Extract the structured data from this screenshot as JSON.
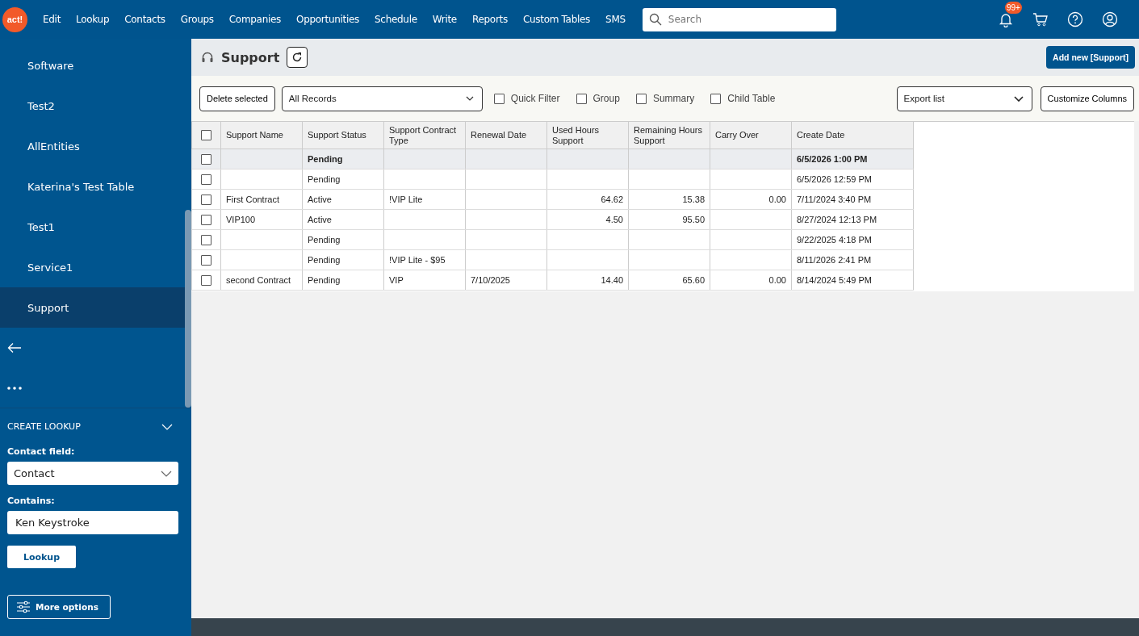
{
  "top_bar": {
    "logo": "act!",
    "menu": [
      "Edit",
      "Lookup",
      "Contacts",
      "Groups",
      "Companies",
      "Opportunities",
      "Schedule",
      "Write",
      "Reports",
      "Custom Tables",
      "SMS"
    ],
    "search": {
      "placeholder": "Search"
    },
    "notification_badge": "99+"
  },
  "sidebar": {
    "items": [
      {
        "label": "Software",
        "selected": false
      },
      {
        "label": "Test2",
        "selected": false
      },
      {
        "label": "AllEntities",
        "selected": false
      },
      {
        "label": "Katerina's Test Table",
        "selected": false
      },
      {
        "label": "Test1",
        "selected": false
      },
      {
        "label": "Service1",
        "selected": false
      },
      {
        "label": "Support",
        "selected": true
      }
    ],
    "lookup": {
      "title": "CREATE LOOKUP",
      "field_label": "Contact field:",
      "field_value": "Contact",
      "contains_label": "Contains:",
      "contains_value": "Ken Keystroke",
      "lookup_button": "Lookup",
      "more_options": "More options"
    }
  },
  "page": {
    "title": "Support",
    "add_button": "Add new [Support]"
  },
  "toolbar": {
    "delete_button": "Delete selected",
    "view_select": "All Records",
    "checkboxes": [
      {
        "label": "Quick Filter",
        "checked": false
      },
      {
        "label": "Group",
        "checked": false
      },
      {
        "label": "Summary",
        "checked": false
      },
      {
        "label": "Child Table",
        "checked": false
      }
    ],
    "export_select": "Export list",
    "customize_button": "Customize Columns"
  },
  "table": {
    "select_all_checked": false,
    "columns": [
      {
        "label": "Support Name",
        "kind": "text"
      },
      {
        "label": "Support Status",
        "kind": "text"
      },
      {
        "label": "Support Contract Type",
        "kind": "text"
      },
      {
        "label": "Renewal Date",
        "kind": "text"
      },
      {
        "label": "Used Hours Support",
        "kind": "number"
      },
      {
        "label": "Remaining Hours Support",
        "kind": "number"
      },
      {
        "label": "Carry Over",
        "kind": "number"
      },
      {
        "label": "Create Date",
        "kind": "text"
      }
    ],
    "rows": [
      {
        "selected": true,
        "checked": false,
        "cells": [
          "",
          "Pending",
          "",
          "",
          "",
          "",
          "",
          "6/5/2026 1:00 PM"
        ]
      },
      {
        "selected": false,
        "checked": false,
        "cells": [
          "",
          "Pending",
          "",
          "",
          "",
          "",
          "",
          "6/5/2026 12:59 PM"
        ]
      },
      {
        "selected": false,
        "checked": false,
        "cells": [
          "First Contract",
          "Active",
          "!VIP Lite",
          "",
          "64.62",
          "15.38",
          "0.00",
          "7/11/2024 3:40 PM"
        ]
      },
      {
        "selected": false,
        "checked": false,
        "cells": [
          "VIP100",
          "Active",
          "",
          "",
          "4.50",
          "95.50",
          "",
          "8/27/2024 12:13 PM"
        ]
      },
      {
        "selected": false,
        "checked": false,
        "cells": [
          "",
          "Pending",
          "",
          "",
          "",
          "",
          "",
          "9/22/2025 4:18 PM"
        ]
      },
      {
        "selected": false,
        "checked": false,
        "cells": [
          "",
          "Pending",
          "!VIP Lite - $95",
          "",
          "",
          "",
          "",
          "8/11/2026 2:41 PM"
        ]
      },
      {
        "selected": false,
        "checked": false,
        "cells": [
          "second Contract",
          "Pending",
          "VIP",
          "7/10/2025",
          "14.40",
          "65.60",
          "0.00",
          "8/14/2024 5:49 PM"
        ]
      }
    ]
  }
}
